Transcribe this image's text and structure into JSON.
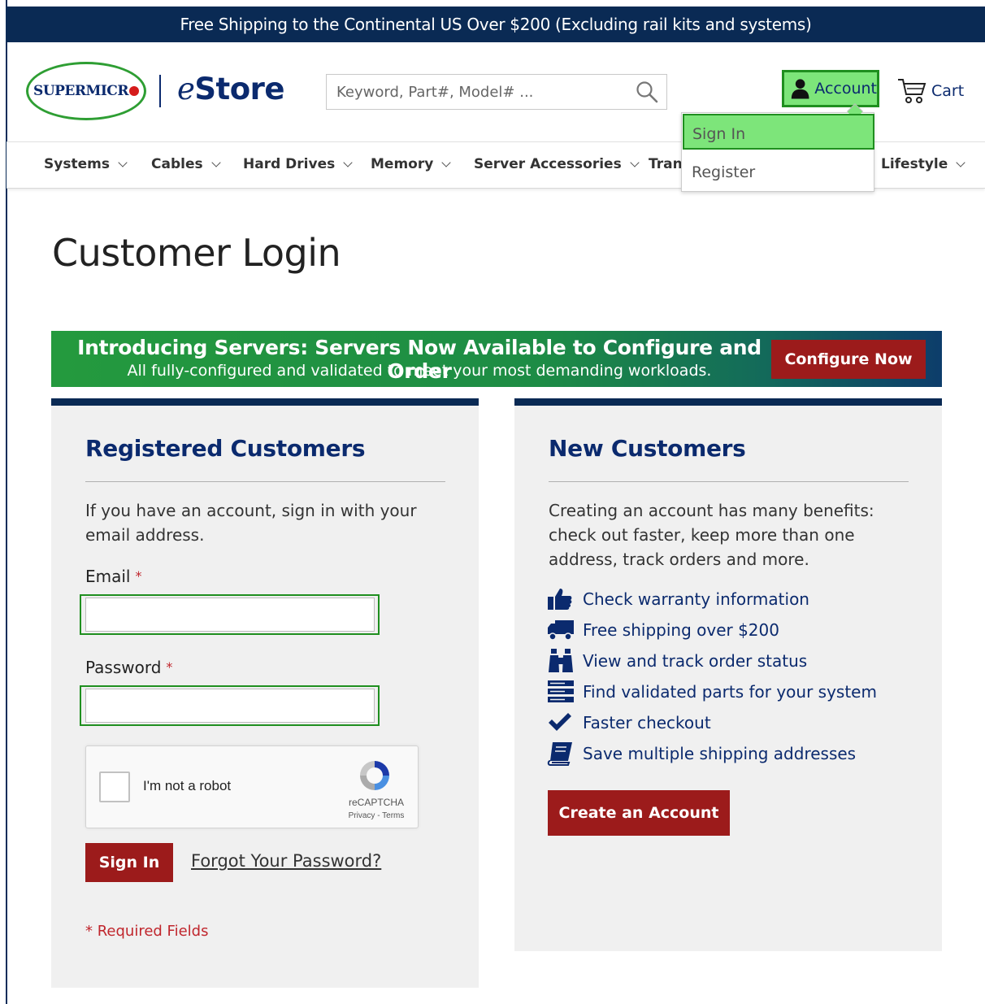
{
  "topbar": {
    "text": "Free Shipping to the Continental US Over $200 (Excluding rail kits and systems)"
  },
  "header": {
    "logo_text": "SUPERMICR",
    "store_e": "e",
    "store_name": "Store",
    "search_placeholder": "Keyword, Part#, Model# ...",
    "account_label": "Account",
    "cart_label": "Cart"
  },
  "account_menu": {
    "signin": "Sign In",
    "register": "Register"
  },
  "nav": {
    "items": [
      {
        "label": "Systems"
      },
      {
        "label": "Cables"
      },
      {
        "label": "Hard Drives"
      },
      {
        "label": "Memory"
      },
      {
        "label": "Server Accessories"
      },
      {
        "label": "Trans"
      },
      {
        "label": "Lifestyle"
      }
    ]
  },
  "page": {
    "title": "Customer Login"
  },
  "banner": {
    "title": "Introducing Servers: Servers Now Available to Configure and Order",
    "subtitle": "All fully-configured and validated to meet your most demanding workloads.",
    "button": "Configure Now"
  },
  "registered": {
    "title": "Registered Customers",
    "intro": "If you have an account, sign in with your email address.",
    "email_label": "Email",
    "email_value": "",
    "password_label": "Password",
    "password_value": "",
    "required_marker": "*",
    "captcha_label": "I'm not a robot",
    "captcha_brand": "reCAPTCHA",
    "captcha_links": "Privacy - Terms",
    "signin_button": "Sign In",
    "forgot_link": "Forgot Your Password?",
    "required_note": "* Required Fields"
  },
  "new_customers": {
    "title": "New Customers",
    "intro": "Creating an account has many benefits: check out faster, keep more than one address, track orders and more.",
    "benefits": [
      {
        "icon": "thumbs-up-icon",
        "text": "Check warranty information"
      },
      {
        "icon": "truck-icon",
        "text": "Free shipping over $200"
      },
      {
        "icon": "binoculars-icon",
        "text": "View and track order status"
      },
      {
        "icon": "server-icon",
        "text": "Find validated parts for your system"
      },
      {
        "icon": "checkmark-icon",
        "text": "Faster checkout"
      },
      {
        "icon": "book-icon",
        "text": "Save multiple shipping addresses"
      }
    ],
    "create_button": "Create an Account"
  },
  "colors": {
    "navy": "#0a2a54",
    "brand_blue": "#0b2a6e",
    "button_red": "#9c1b1b",
    "highlight_green": "#7de57a",
    "required_red": "#c0262d"
  }
}
